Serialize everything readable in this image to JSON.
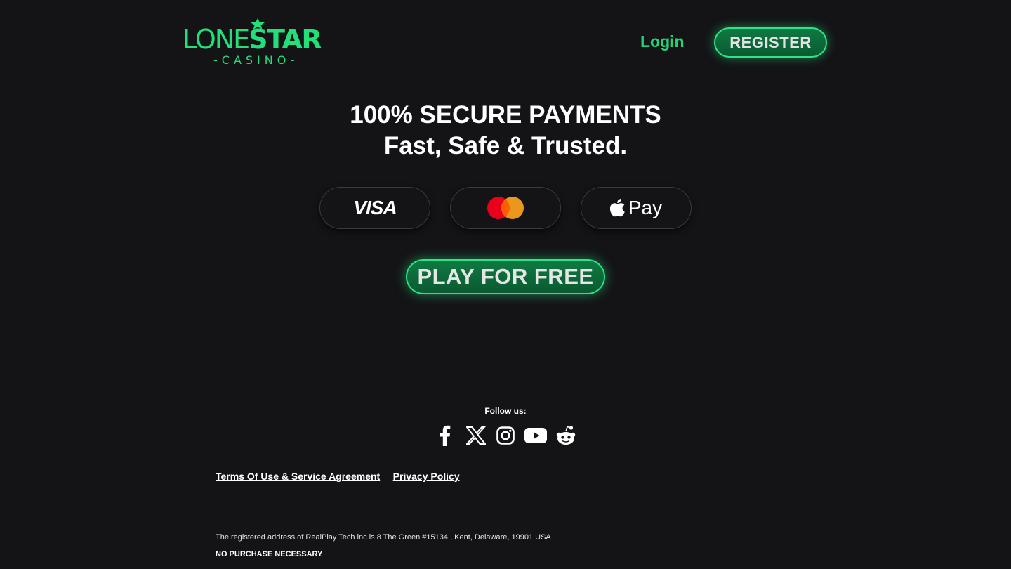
{
  "header": {
    "logo": {
      "word_left": "LONE",
      "word_right": "STAR",
      "subtitle": "-CASINO-"
    },
    "login_label": "Login",
    "register_label": "REGISTER"
  },
  "hero": {
    "headline_line1": "100% SECURE PAYMENTS",
    "headline_line2": "Fast, Safe & Trusted.",
    "payment_methods": [
      {
        "name": "VISA",
        "icon": "visa-logo"
      },
      {
        "name": "Mastercard",
        "icon": "mastercard-logo"
      },
      {
        "name": "Pay",
        "icon": "apple-pay-logo"
      }
    ],
    "play_label": "PLAY FOR FREE"
  },
  "footer": {
    "follow_label": "Follow us:",
    "socials": [
      "facebook-icon",
      "x-icon",
      "instagram-icon",
      "youtube-icon",
      "reddit-icon"
    ],
    "links": {
      "terms": "Terms Of Use & Service Agreement",
      "privacy": "Privacy Policy"
    },
    "address": "The registered address of RealPlay Tech inc is 8 The Green #15134 , Kent, Delaware, 19901 USA",
    "no_purchase": "NO PURCHASE NECESSARY"
  },
  "colors": {
    "background": "#141417",
    "brand_green": "#21e07a",
    "button_green": "#0f7a43",
    "mastercard_red": "#eb001b",
    "mastercard_orange": "#f79e1b"
  }
}
